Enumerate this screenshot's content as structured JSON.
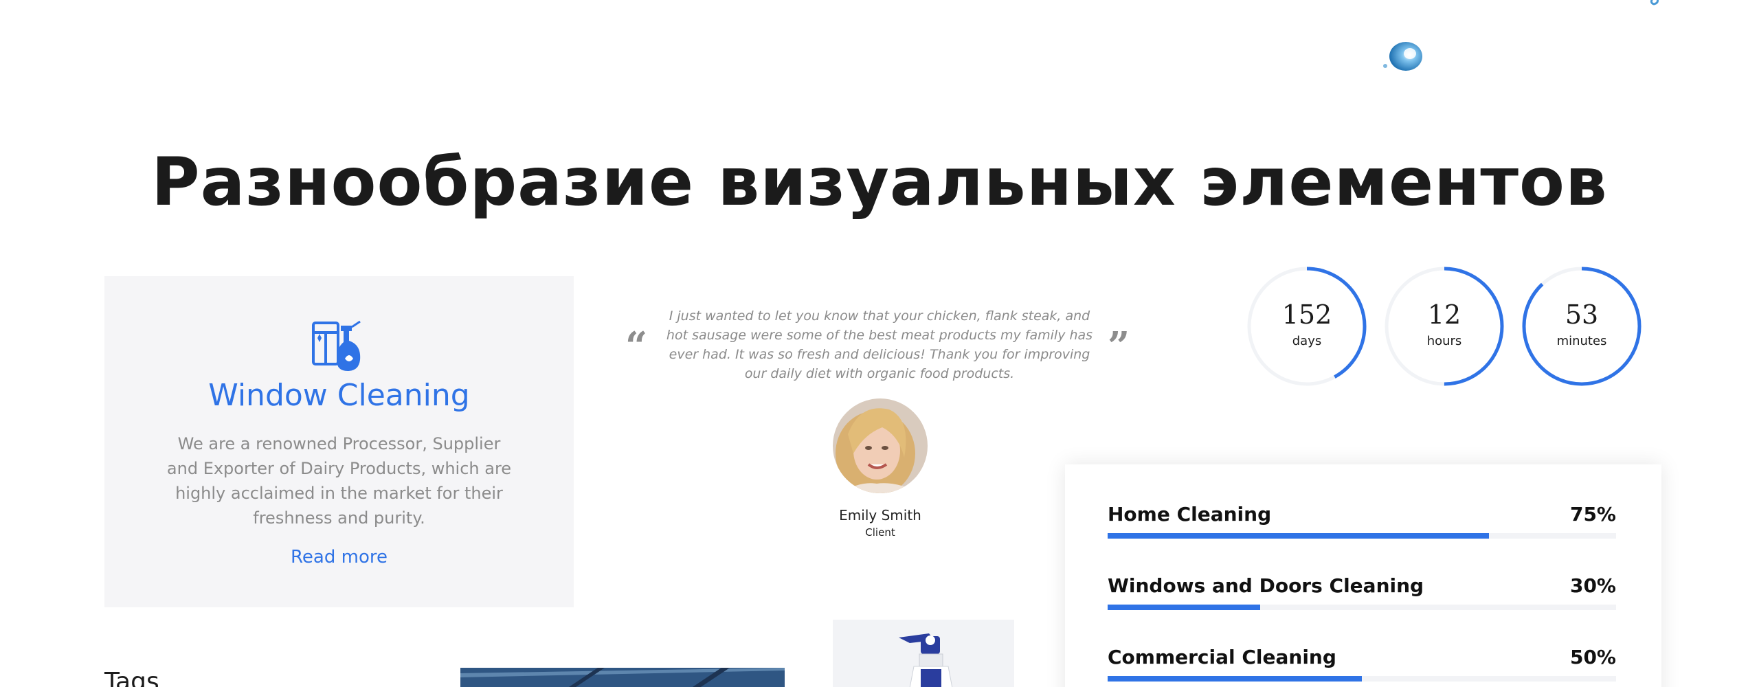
{
  "heading": "Разнообразие визуальных элементов",
  "service": {
    "title": "Window Cleaning",
    "text": "We are a renowned Processor, Supplier and Exporter of Dairy Products, which are highly acclaimed in the market for their freshness and purity.",
    "link": "Read more",
    "icon": "window-spray-icon"
  },
  "testimonial": {
    "quote": "I just wanted to let you know that your chicken, flank steak, and hot sausage were some of the best meat products my family has ever had. It was so fresh and delicious! Thank you for improving our daily diet with organic food products.",
    "name": "Emily Smith",
    "role": "Client"
  },
  "countdown": {
    "days": {
      "value": "152",
      "label": "days",
      "fraction": 0.42
    },
    "hours": {
      "value": "12",
      "label": "hours",
      "fraction": 0.5
    },
    "minutes": {
      "value": "53",
      "label": "minutes",
      "fraction": 0.88
    }
  },
  "progress": [
    {
      "label": "Home Cleaning",
      "value": "75%",
      "percent": 75
    },
    {
      "label": "Windows and Doors Cleaning",
      "value": "30%",
      "percent": 30
    },
    {
      "label": "Commercial Cleaning",
      "value": "50%",
      "percent": 50
    }
  ],
  "tags_heading": "Tags",
  "colors": {
    "accent": "#2f73e6",
    "card_bg": "#f5f5f7",
    "track": "#f2f3f6"
  }
}
